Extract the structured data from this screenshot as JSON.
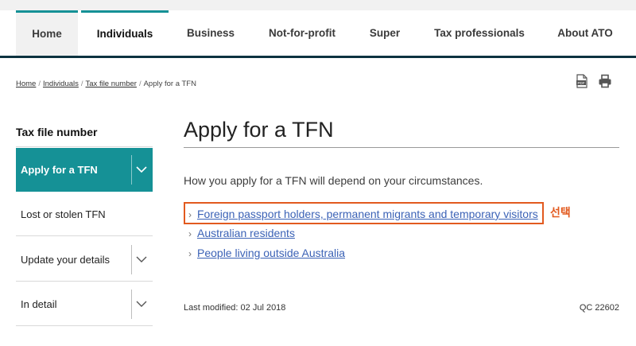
{
  "nav": {
    "items": [
      "Home",
      "Individuals",
      "Business",
      "Not-for-profit",
      "Super",
      "Tax professionals",
      "About ATO"
    ],
    "active": "Individuals"
  },
  "breadcrumb": {
    "items": [
      "Home",
      "Individuals",
      "Tax file number",
      "Apply for a TFN"
    ]
  },
  "toolbar": {
    "icons": [
      "pdf-icon",
      "print-icon"
    ]
  },
  "sidebar": {
    "title": "Tax file number",
    "items": [
      {
        "label": "Apply for a TFN",
        "active": true,
        "expandable": true
      },
      {
        "label": "Lost or stolen TFN",
        "active": false,
        "expandable": false
      },
      {
        "label": "Update your details",
        "active": false,
        "expandable": true
      },
      {
        "label": "In detail",
        "active": false,
        "expandable": true
      }
    ]
  },
  "main": {
    "title": "Apply for a TFN",
    "intro": "How you apply for a TFN will depend on your circumstances.",
    "links": [
      "Foreign passport holders, permanent migrants and temporary visitors",
      "Australian residents",
      "People living outside Australia"
    ],
    "annotation": "선택",
    "last_modified": "Last modified: 02 Jul 2018",
    "qc": "QC 22602"
  },
  "colors": {
    "teal": "#159196",
    "navy_rule": "#0d3340",
    "link": "#3b62b6",
    "annotation": "#e25a1f"
  }
}
